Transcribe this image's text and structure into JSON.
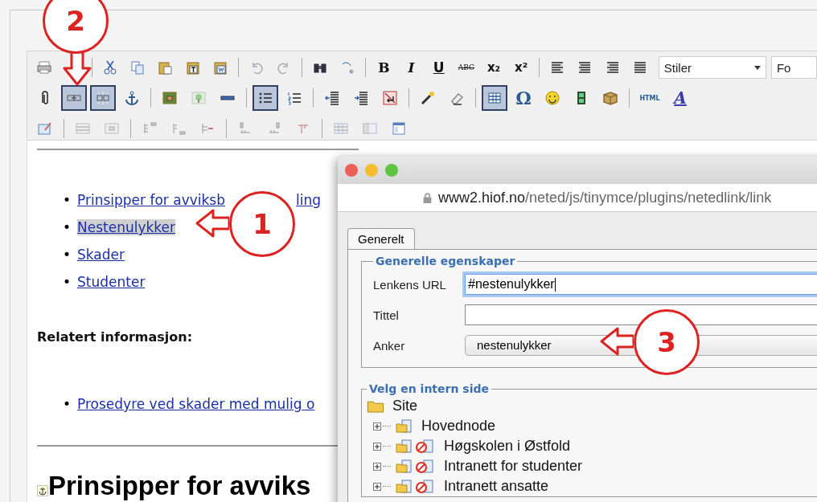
{
  "toolbar": {
    "rows": [
      {
        "groups": [
          [
            {
              "kind": "printer",
              "active": false
            }
          ],
          [
            {
              "kind": "scissors",
              "active": false
            },
            {
              "kind": "copy",
              "active": false
            },
            {
              "kind": "paste",
              "active": false
            },
            {
              "kind": "paste-text",
              "active": false
            },
            {
              "kind": "paste-word",
              "active": false
            }
          ],
          [
            {
              "kind": "undo",
              "active": false
            },
            {
              "kind": "redo",
              "active": false
            }
          ],
          [
            {
              "kind": "binoculars",
              "active": false
            },
            {
              "kind": "replace",
              "active": false
            }
          ],
          [
            {
              "kind": "bold",
              "label": "B",
              "active": false
            },
            {
              "kind": "italic",
              "label": "I",
              "active": false
            },
            {
              "kind": "underline",
              "label": "U",
              "active": false
            },
            {
              "kind": "strike",
              "label": "ABC",
              "active": false
            },
            {
              "kind": "sub",
              "label": "x₂",
              "active": false
            },
            {
              "kind": "sup",
              "label": "x²",
              "active": false
            }
          ],
          [
            {
              "kind": "align-left",
              "active": false
            },
            {
              "kind": "align-center",
              "active": false
            },
            {
              "kind": "align-right",
              "active": false
            },
            {
              "kind": "justify",
              "active": false
            },
            {
              "kind": "select",
              "label": "Stiler",
              "active": false
            },
            {
              "kind": "select-cut",
              "label": "Fo",
              "active": false
            }
          ]
        ]
      },
      {
        "groups": [
          [
            {
              "kind": "paperclip",
              "active": false
            },
            {
              "kind": "link",
              "active": true
            },
            {
              "kind": "unlink",
              "active": true
            },
            {
              "kind": "anchor",
              "active": false
            }
          ],
          [
            {
              "kind": "image",
              "active": false
            },
            {
              "kind": "tree-image",
              "active": false
            },
            {
              "kind": "rule",
              "active": false
            }
          ],
          [
            {
              "kind": "bullets",
              "active": true
            },
            {
              "kind": "numbers",
              "active": false
            }
          ],
          [
            {
              "kind": "outdent",
              "active": false
            },
            {
              "kind": "indent",
              "active": false
            },
            {
              "kind": "nobreak",
              "active": false
            }
          ],
          [
            {
              "kind": "wand",
              "active": false
            },
            {
              "kind": "eraser",
              "active": false
            }
          ],
          [
            {
              "kind": "table",
              "active": true
            },
            {
              "kind": "omega",
              "label": "Ω",
              "active": false
            },
            {
              "kind": "smiley",
              "active": false
            },
            {
              "kind": "film",
              "active": false
            },
            {
              "kind": "box",
              "active": false
            }
          ],
          [
            {
              "kind": "html",
              "label": "HTML",
              "active": false
            },
            {
              "kind": "font",
              "label": "A",
              "active": false
            }
          ]
        ]
      },
      {
        "groups": [
          [
            {
              "kind": "table-edit",
              "active": false
            }
          ],
          [
            {
              "kind": "row-props",
              "active": false
            },
            {
              "kind": "cell-props",
              "active": false
            }
          ],
          [
            {
              "kind": "row-before",
              "active": false
            },
            {
              "kind": "row-after",
              "active": false
            },
            {
              "kind": "row-delete",
              "active": false
            }
          ],
          [
            {
              "kind": "col-before",
              "active": false
            },
            {
              "kind": "col-after",
              "active": false
            },
            {
              "kind": "col-delete",
              "active": false
            }
          ],
          [
            {
              "kind": "table-grid",
              "active": false
            },
            {
              "kind": "table-split",
              "active": false
            },
            {
              "kind": "table-props",
              "active": false
            }
          ]
        ]
      }
    ]
  },
  "content": {
    "links": [
      {
        "marker": "•",
        "text": "Prinsipper for avviksb",
        "rest": "ling",
        "selected": false
      },
      {
        "marker": "•",
        "text": "Nestenulykker",
        "selected": true
      },
      {
        "marker": "•",
        "text": "Skader",
        "selected": false
      },
      {
        "marker": "•",
        "text": "Studenter",
        "selected": false
      }
    ],
    "related_heading": "Relatert informasjon:",
    "related_links": [
      {
        "marker": "•",
        "text": "Prosedyre ved skader med mulig o"
      }
    ],
    "heading": "Prinsipper for avviks"
  },
  "popup": {
    "url_domain": "www2.hiof.no",
    "url_path": "/neted/js/tinymce/plugins/netedlink/link",
    "tabs": [
      {
        "label": "Generelt",
        "selected": true
      }
    ],
    "general": {
      "legend": "Generelle egenskaper",
      "fields": [
        {
          "label": "Lenkens URL",
          "value": "#nestenulykker",
          "kind": "text",
          "focused": true
        },
        {
          "label": "Tittel",
          "kind": "text",
          "focused": false
        },
        {
          "label": "Anker",
          "value": "nestenulykker",
          "kind": "select",
          "focused": false
        }
      ]
    },
    "internal": {
      "legend": "Velg en intern side",
      "tree": {
        "label": "Site",
        "children": [
          {
            "label": "Hovednode",
            "kind": "page",
            "expanded": false
          },
          {
            "label": "Høgskolen i Østfold",
            "kind": "restricted",
            "expanded": false
          },
          {
            "label": "Intranett for studenter",
            "kind": "restricted",
            "expanded": false
          },
          {
            "label": "Intranett ansatte",
            "kind": "restricted",
            "expanded": false
          }
        ]
      }
    }
  },
  "callouts": [
    {
      "number": "2"
    },
    {
      "number": "1"
    },
    {
      "number": "3"
    }
  ]
}
